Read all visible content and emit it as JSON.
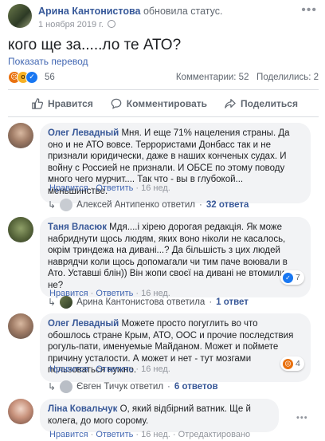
{
  "post": {
    "author": "Арина Кантонистова",
    "action": "обновила статус.",
    "date": "1 ноября 2019 г.",
    "text": "кого ще за.....ло те АТО?",
    "translate": "Показать перевод",
    "reactions_count": "56",
    "stats": "Комментарии: 52   Поделились: 2"
  },
  "actions": {
    "like": "Нравится",
    "comment": "Комментировать",
    "share": "Поделиться"
  },
  "comments": [
    {
      "author": "Олег Левадный",
      "text": "Мня. И еще 71% нацеления страны. Да оно и не АТО вовсе. Террористами Донбасс так и не признали юридически, даже в наших конченых судах. И войну с Россией не признали. И ОБСЕ по этому поводу много чего мурчит.... Так что - вы в глубокой... меньшинстве.",
      "like_label": "Нравится",
      "reply_label": "Ответить",
      "age": "16 нед.",
      "reply_author": "Алексей Антипенко ответил",
      "reply_count": "32 ответа"
    },
    {
      "author": "Таня Власюк",
      "text": "Мдя....і хірею дорогая редакція. Як може набридну­ти щось людям, яких воно ніколи не касалось, окрім триндежа на дивані...? Да більшість з цих людей навряд­чи коли щось допомагали чи тим паче воювали в Ато. Уставші блін)) Він жопи своєї на дивані не втомились, не?",
      "like_label": "Нравится",
      "reply_label": "Ответить",
      "age": "16 нед.",
      "badge_count": "7",
      "reply_author": "Арина Кантонистова ответила",
      "reply_count": "1 ответ"
    },
    {
      "author": "Олег Левадный",
      "text": "Можете просто погуглить во что обошлось стране Крым, АТО, ООС и прочие последствия рогуль-пати, именуемые Майданом. Может и поймете причину усталости. А может и нет - тут мозгами пользоваться нужно.",
      "like_label": "Нравится",
      "reply_label": "Ответить",
      "age": "16 нед.",
      "badge_count": "4",
      "reply_author": "Євген Тичук ответил",
      "reply_count": "6 ответов"
    },
    {
      "author": "Ліна Ковальчук",
      "text": "О, який відбірний ватник. Ще й колега, до мого сорому.",
      "like_label": "Нравится",
      "reply_label": "Ответить",
      "age": "16 нед.",
      "edited": "Отредактировано"
    }
  ],
  "colors": {
    "link": "#385898",
    "muted": "#606770",
    "bubble": "#f2f3f5",
    "like_blue": "#1877f2",
    "angry_orange": "#e9710f"
  },
  "icons": {
    "like": "thumbs-up-icon",
    "comment": "speech-bubble-icon",
    "share": "share-arrow-icon",
    "more": "more-dots-icon",
    "privacy": "globe-icon",
    "reply": "reply-arrow-icon"
  }
}
